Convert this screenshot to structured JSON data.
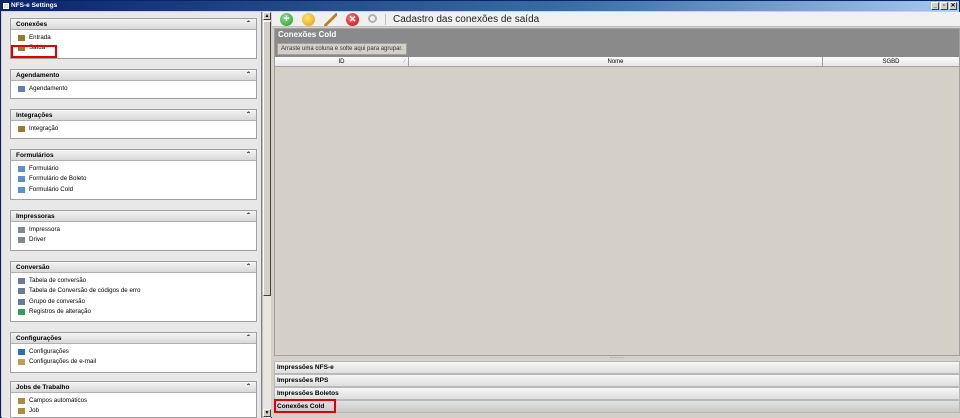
{
  "window": {
    "title": "NFS-e Settings",
    "controls": [
      "_",
      "▫",
      "✕"
    ]
  },
  "sidebar": {
    "groups": [
      {
        "title": "Conexões",
        "items": [
          {
            "label": "Entrada",
            "icon": "entrada-icon"
          },
          {
            "label": "Saída",
            "icon": "saida-icon"
          }
        ]
      },
      {
        "title": "Agendamento",
        "items": [
          {
            "label": "Agendamento",
            "icon": "calendar-icon"
          }
        ]
      },
      {
        "title": "Integrações",
        "items": [
          {
            "label": "Integração",
            "icon": "integration-icon"
          }
        ]
      },
      {
        "title": "Formulários",
        "items": [
          {
            "label": "Formulário",
            "icon": "form-icon"
          },
          {
            "label": "Formulário de Boleto",
            "icon": "form-icon"
          },
          {
            "label": "Formulário Cold",
            "icon": "form-icon"
          }
        ]
      },
      {
        "title": "Impressoras",
        "items": [
          {
            "label": "Impressora",
            "icon": "printer-icon"
          },
          {
            "label": "Driver",
            "icon": "driver-icon"
          }
        ]
      },
      {
        "title": "Conversão",
        "items": [
          {
            "label": "Tabela de conversão",
            "icon": "table-icon"
          },
          {
            "label": "Tabela de Conversão de códigos de erro",
            "icon": "table-icon"
          },
          {
            "label": "Grupo de conversão",
            "icon": "group-icon"
          },
          {
            "label": "Registros de alteração",
            "icon": "log-icon"
          }
        ]
      },
      {
        "title": "Configurações",
        "items": [
          {
            "label": "Configurações",
            "icon": "globe-icon"
          },
          {
            "label": "Configurações de e-mail",
            "icon": "email-icon"
          }
        ]
      },
      {
        "title": "Jobs de Trabalho",
        "items": [
          {
            "label": "Campos automáticos",
            "icon": "fields-icon"
          },
          {
            "label": "Job",
            "icon": "job-icon"
          }
        ]
      }
    ]
  },
  "toolbar": {
    "title": "Cadastro das conexões de saída",
    "buttons": [
      "add-icon",
      "smiley-icon",
      "edit-icon",
      "delete-icon",
      "search-icon"
    ]
  },
  "grid": {
    "title": "Conexões Cold",
    "group_hint": "Arraste uma coluna e solte aqui para agrupar.",
    "columns": [
      "ID",
      "Nome",
      "SGBD"
    ]
  },
  "bottom_bars": [
    "Impressões NFS-e",
    "Impressões RPS",
    "Impressões Boletos",
    "Conexões Cold"
  ],
  "colors": {
    "highlight": "#e00000",
    "title_bar": "#0a246a",
    "grid_header": "#8a8a8a"
  }
}
